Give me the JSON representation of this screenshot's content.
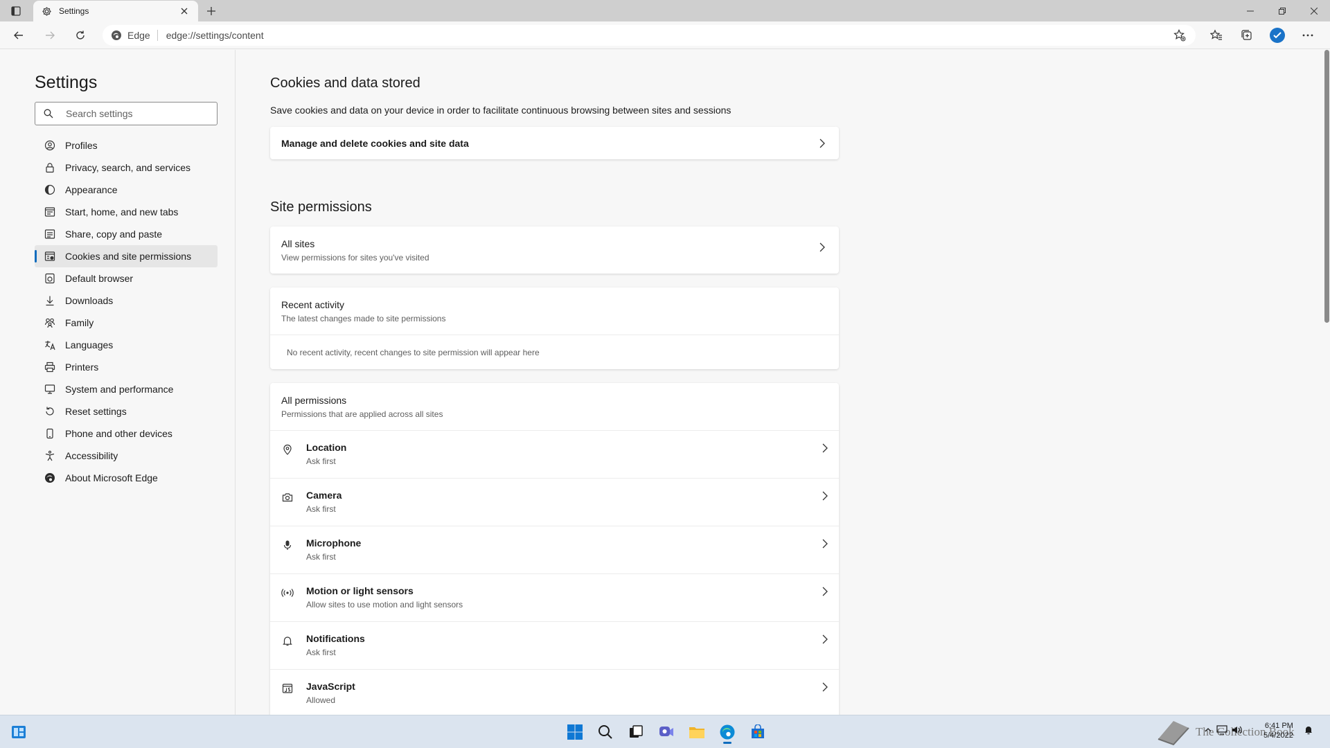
{
  "browser": {
    "tab_title": "Settings",
    "omnibox_brand": "Edge",
    "url": "edge://settings/content"
  },
  "sidebar": {
    "title": "Settings",
    "search_placeholder": "Search settings",
    "items": [
      {
        "label": "Profiles",
        "icon": "profile-icon",
        "active": false
      },
      {
        "label": "Privacy, search, and services",
        "icon": "lock-icon",
        "active": false
      },
      {
        "label": "Appearance",
        "icon": "appearance-icon",
        "active": false
      },
      {
        "label": "Start, home, and new tabs",
        "icon": "start-icon",
        "active": false
      },
      {
        "label": "Share, copy and paste",
        "icon": "share-icon",
        "active": false
      },
      {
        "label": "Cookies and site permissions",
        "icon": "cookies-icon",
        "active": true
      },
      {
        "label": "Default browser",
        "icon": "browser-icon",
        "active": false
      },
      {
        "label": "Downloads",
        "icon": "download-icon",
        "active": false
      },
      {
        "label": "Family",
        "icon": "family-icon",
        "active": false
      },
      {
        "label": "Languages",
        "icon": "languages-icon",
        "active": false
      },
      {
        "label": "Printers",
        "icon": "printer-icon",
        "active": false
      },
      {
        "label": "System and performance",
        "icon": "system-icon",
        "active": false
      },
      {
        "label": "Reset settings",
        "icon": "reset-icon",
        "active": false
      },
      {
        "label": "Phone and other devices",
        "icon": "phone-icon",
        "active": false
      },
      {
        "label": "Accessibility",
        "icon": "accessibility-icon",
        "active": false
      },
      {
        "label": "About Microsoft Edge",
        "icon": "edge-icon",
        "active": false
      }
    ]
  },
  "main": {
    "cookies": {
      "title": "Cookies and data stored",
      "description": "Save cookies and data on your device in order to facilitate continuous browsing between sites and sessions",
      "manage_label": "Manage and delete cookies and site data"
    },
    "site_permissions": {
      "title": "Site permissions",
      "all_sites": {
        "title": "All sites",
        "subtitle": "View permissions for sites you've visited"
      },
      "recent_activity": {
        "title": "Recent activity",
        "subtitle": "The latest changes made to site permissions",
        "empty_text": "No recent activity, recent changes to site permission will appear here"
      },
      "all_permissions": {
        "title": "All permissions",
        "subtitle": "Permissions that are applied across all sites",
        "items": [
          {
            "title": "Location",
            "status": "Ask first",
            "icon": "location-icon"
          },
          {
            "title": "Camera",
            "status": "Ask first",
            "icon": "camera-icon"
          },
          {
            "title": "Microphone",
            "status": "Ask first",
            "icon": "microphone-icon"
          },
          {
            "title": "Motion or light sensors",
            "status": "Allow sites to use motion and light sensors",
            "icon": "sensors-icon"
          },
          {
            "title": "Notifications",
            "status": "Ask first",
            "icon": "bell-icon"
          },
          {
            "title": "JavaScript",
            "status": "Allowed",
            "icon": "javascript-icon"
          }
        ]
      }
    }
  },
  "taskbar": {
    "watermark": "The Collection Book",
    "time": "6:41 PM",
    "date": "5/4/2022"
  },
  "colors": {
    "accent": "#0f6cbd",
    "background": "#f7f7f7",
    "card": "#ffffff",
    "titlebar": "#cfcfcf",
    "taskbar": "#dbe4ef"
  }
}
